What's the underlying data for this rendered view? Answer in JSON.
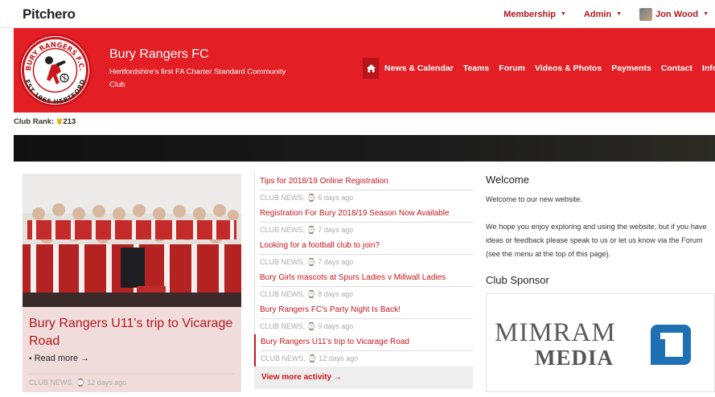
{
  "topbar": {
    "brand": "Pitchero",
    "membership": "Membership",
    "admin": "Admin",
    "user": "Jon Wood"
  },
  "header": {
    "club_name": "Bury Rangers FC",
    "club_sub": "Hertfordshire's first FA Charter Standard Community Club",
    "crest_top": "BURY RANGERS F.C.",
    "crest_bottom": "EST 1965 HERTFORD",
    "nav": [
      "News & Calendar",
      "Teams",
      "Forum",
      "Videos & Photos",
      "Payments",
      "Contact",
      "Information"
    ]
  },
  "rank": {
    "label": "Club Rank:",
    "value": "213"
  },
  "feature": {
    "title": "Bury Rangers U11's trip to Vicarage Road",
    "read_more": "Read more →",
    "category": "CLUB NEWS,",
    "age": "12 days ago"
  },
  "news": [
    {
      "title": "Tips for 2018/19 Online Registration",
      "category": "CLUB NEWS,",
      "age": "6 days ago"
    },
    {
      "title": "Registration For Bury 2018/19 Season Now Available",
      "category": "CLUB NEWS,",
      "age": "7 days ago"
    },
    {
      "title": "Looking for a football club to join?",
      "category": "CLUB NEWS,",
      "age": "7 days ago"
    },
    {
      "title": "Bury Girls mascots at Spurs Ladies v Millwall Ladies",
      "category": "CLUB NEWS,",
      "age": "8 days ago"
    },
    {
      "title": "Bury Rangers FC's Party Night Is Back!",
      "category": "CLUB NEWS,",
      "age": "9 days ago"
    },
    {
      "title": "Bury Rangers U11's trip to Vicarage Road",
      "category": "CLUB NEWS,",
      "age": "12 days ago"
    }
  ],
  "view_more": "View more activity →",
  "welcome": {
    "heading": "Welcome",
    "p1": "Welcome to our new website.",
    "p2": "We hope you enjoy exploring and using the website, but if you have ideas or feedback please speak to us or let us know via the Forum (see the menu at the top of this page)."
  },
  "sponsor": {
    "heading": "Club Sponsor",
    "logo_top": "MIMRAM",
    "logo_bottom": "MEDIA"
  },
  "colors": {
    "brand_red": "#e31e24",
    "link_red": "#c8161c",
    "sponsor_blue": "#1f6fb5"
  }
}
